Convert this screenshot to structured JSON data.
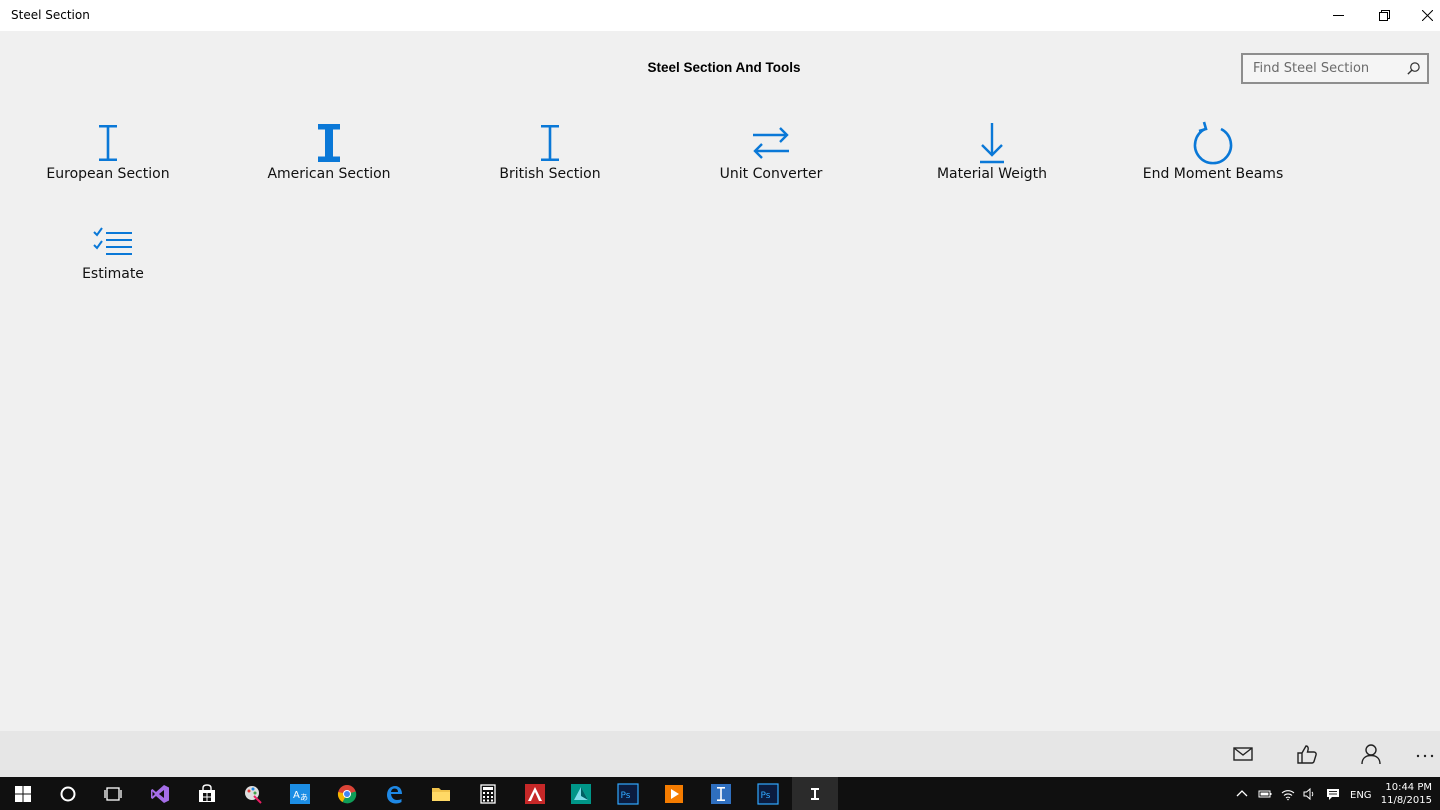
{
  "window": {
    "title": "Steel Section"
  },
  "header": {
    "title": "Steel Section And Tools"
  },
  "search": {
    "placeholder": "Find Steel Section"
  },
  "tiles": [
    {
      "label": "European Section",
      "icon": "i-beam-thin-icon"
    },
    {
      "label": "American Section",
      "icon": "i-beam-bold-icon"
    },
    {
      "label": "British Section",
      "icon": "i-beam-thin-icon"
    },
    {
      "label": "Unit Converter",
      "icon": "swap-arrows-icon"
    },
    {
      "label": "Material Weigth",
      "icon": "arrow-down-icon"
    },
    {
      "label": "End Moment Beams",
      "icon": "refresh-icon"
    },
    {
      "label": "Estimate",
      "icon": "checklist-icon"
    }
  ],
  "commandbar": [
    "mail-icon",
    "thumbs-up-icon",
    "person-icon",
    "more-icon"
  ],
  "taskbar": {
    "language": "ENG",
    "time": "10:44 PM",
    "date": "11/8/2015"
  },
  "colors": {
    "accent": "#0a78d7",
    "background": "#f0f0f0",
    "commandbar": "#e6e6e6",
    "taskbar": "#101010"
  }
}
